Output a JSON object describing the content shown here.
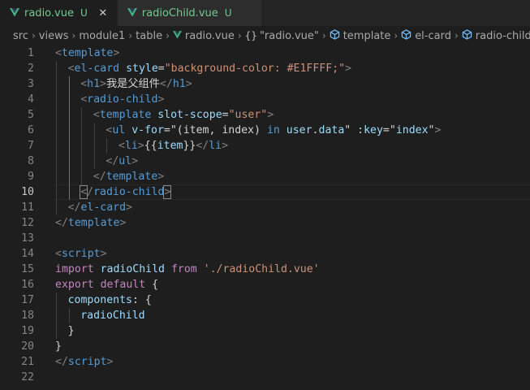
{
  "tabs": [
    {
      "name": "radio.vue",
      "status": "U",
      "active": true,
      "close": "✕"
    },
    {
      "name": "radioChild.vue",
      "status": "U",
      "active": false
    }
  ],
  "breadcrumb": [
    "src",
    "views",
    "module1",
    "table",
    "radio.vue",
    "\"radio.vue\"",
    "template",
    "el-card",
    "radio-child"
  ],
  "editor": {
    "current_line": 10,
    "lines": [
      {
        "n": "1",
        "indent": 0,
        "tokens": [
          [
            "t-punct",
            "<"
          ],
          [
            "t-tag",
            "template"
          ],
          [
            "t-punct",
            ">"
          ]
        ]
      },
      {
        "n": "2",
        "indent": 1,
        "tokens": [
          [
            "t-punct",
            "<"
          ],
          [
            "t-tag",
            "el-card"
          ],
          [
            "t-text",
            " "
          ],
          [
            "t-attr",
            "style"
          ],
          [
            "t-text",
            "="
          ],
          [
            "t-str",
            "\"background-color: #E1FFFF;\""
          ],
          [
            "t-punct",
            ">"
          ]
        ]
      },
      {
        "n": "3",
        "indent": 2,
        "tokens": [
          [
            "t-punct",
            "<"
          ],
          [
            "t-tag",
            "h1"
          ],
          [
            "t-punct",
            ">"
          ],
          [
            "t-text",
            "我是父组件"
          ],
          [
            "t-punct",
            "</"
          ],
          [
            "t-tag",
            "h1"
          ],
          [
            "t-punct",
            ">"
          ]
        ]
      },
      {
        "n": "4",
        "indent": 2,
        "tokens": [
          [
            "t-punct",
            "<"
          ],
          [
            "t-tag",
            "radio-child"
          ],
          [
            "t-punct",
            ">"
          ]
        ]
      },
      {
        "n": "5",
        "indent": 3,
        "tokens": [
          [
            "t-punct",
            "<"
          ],
          [
            "t-tag",
            "template"
          ],
          [
            "t-text",
            " "
          ],
          [
            "t-attr",
            "slot-scope"
          ],
          [
            "t-text",
            "="
          ],
          [
            "t-str",
            "\"user\""
          ],
          [
            "t-punct",
            ">"
          ]
        ]
      },
      {
        "n": "6",
        "indent": 4,
        "tokens": [
          [
            "t-punct",
            "<"
          ],
          [
            "t-tag",
            "ul"
          ],
          [
            "t-text",
            " "
          ],
          [
            "t-attr",
            "v-for"
          ],
          [
            "t-text",
            "=\"(item, index) "
          ],
          [
            "t-kw2",
            "in"
          ],
          [
            "t-text",
            " "
          ],
          [
            "t-var",
            "user"
          ],
          [
            "t-text",
            "."
          ],
          [
            "t-var",
            "data"
          ],
          [
            "t-text",
            "\" "
          ],
          [
            "t-attr",
            ":key"
          ],
          [
            "t-text",
            "=\""
          ],
          [
            "t-var",
            "index"
          ],
          [
            "t-text",
            "\""
          ],
          [
            "t-punct",
            ">"
          ]
        ]
      },
      {
        "n": "7",
        "indent": 5,
        "tokens": [
          [
            "t-punct",
            "<"
          ],
          [
            "t-tag",
            "li"
          ],
          [
            "t-punct",
            ">"
          ],
          [
            "t-text",
            "{{"
          ],
          [
            "t-var",
            "item"
          ],
          [
            "t-text",
            "}}"
          ],
          [
            "t-punct",
            "</"
          ],
          [
            "t-tag",
            "li"
          ],
          [
            "t-punct",
            ">"
          ]
        ]
      },
      {
        "n": "8",
        "indent": 4,
        "tokens": [
          [
            "t-punct",
            "</"
          ],
          [
            "t-tag",
            "ul"
          ],
          [
            "t-punct",
            ">"
          ]
        ]
      },
      {
        "n": "9",
        "indent": 3,
        "tokens": [
          [
            "t-punct",
            "</"
          ],
          [
            "t-tag",
            "template"
          ],
          [
            "t-punct",
            ">"
          ]
        ]
      },
      {
        "n": "10",
        "indent": 2,
        "tokens": [
          [
            "t-punct bracket-box",
            "<"
          ],
          [
            "t-punct",
            "/"
          ],
          [
            "t-tag",
            "radio-child"
          ],
          [
            "t-punct bracket-box",
            ">"
          ]
        ]
      },
      {
        "n": "11",
        "indent": 1,
        "tokens": [
          [
            "t-punct",
            "</"
          ],
          [
            "t-tag",
            "el-card"
          ],
          [
            "t-punct",
            ">"
          ]
        ]
      },
      {
        "n": "12",
        "indent": 0,
        "tokens": [
          [
            "t-punct",
            "</"
          ],
          [
            "t-tag",
            "template"
          ],
          [
            "t-punct",
            ">"
          ]
        ]
      },
      {
        "n": "13",
        "indent": 0,
        "tokens": []
      },
      {
        "n": "14",
        "indent": 0,
        "tokens": [
          [
            "t-punct",
            "<"
          ],
          [
            "t-tag",
            "script"
          ],
          [
            "t-punct",
            ">"
          ]
        ]
      },
      {
        "n": "15",
        "indent": 0,
        "tokens": [
          [
            "t-kw",
            "import"
          ],
          [
            "t-text",
            " "
          ],
          [
            "t-var",
            "radioChild"
          ],
          [
            "t-text",
            " "
          ],
          [
            "t-kw",
            "from"
          ],
          [
            "t-text",
            " "
          ],
          [
            "t-str",
            "'./radioChild.vue'"
          ]
        ]
      },
      {
        "n": "16",
        "indent": 0,
        "tokens": [
          [
            "t-kw",
            "export"
          ],
          [
            "t-text",
            " "
          ],
          [
            "t-kw",
            "default"
          ],
          [
            "t-text",
            " {"
          ]
        ]
      },
      {
        "n": "17",
        "indent": 1,
        "tokens": [
          [
            "t-prop",
            "components"
          ],
          [
            "t-text",
            ": {"
          ]
        ]
      },
      {
        "n": "18",
        "indent": 2,
        "tokens": [
          [
            "t-var",
            "radioChild"
          ]
        ]
      },
      {
        "n": "19",
        "indent": 1,
        "tokens": [
          [
            "t-text",
            "}"
          ]
        ]
      },
      {
        "n": "20",
        "indent": 0,
        "tokens": [
          [
            "t-text",
            "}"
          ]
        ]
      },
      {
        "n": "21",
        "indent": 0,
        "tokens": [
          [
            "t-punct",
            "</"
          ],
          [
            "t-tag",
            "script"
          ],
          [
            "t-punct",
            ">"
          ]
        ]
      },
      {
        "n": "22",
        "indent": 0,
        "tokens": []
      }
    ]
  }
}
